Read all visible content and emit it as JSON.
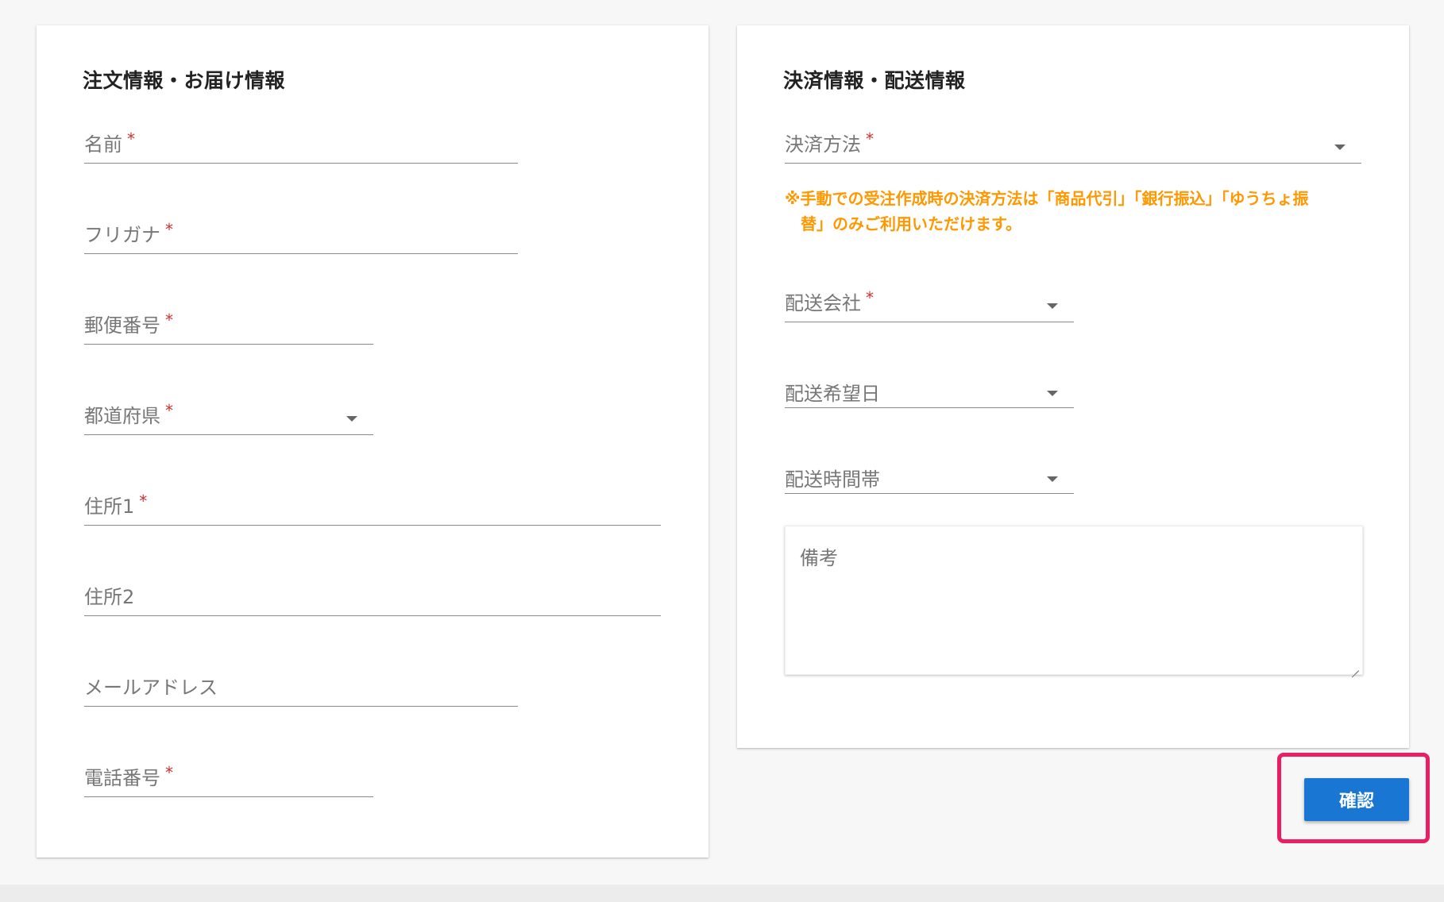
{
  "order_card": {
    "title": "注文情報・お届け情報",
    "fields": [
      {
        "label": "名前",
        "required": true
      },
      {
        "label": "フリガナ",
        "required": true
      },
      {
        "label": "郵便番号",
        "required": true
      },
      {
        "label": "都道府県",
        "required": true,
        "type": "select"
      },
      {
        "label": "住所1",
        "required": true
      },
      {
        "label": "住所2",
        "required": false
      },
      {
        "label": "メールアドレス",
        "required": false
      },
      {
        "label": "電話番号",
        "required": true
      }
    ]
  },
  "payment_card": {
    "title": "決済情報・配送情報",
    "payment_method": {
      "label": "決済方法",
      "required": true,
      "type": "select"
    },
    "note": "※手動での受注作成時の決済方法は「商品代引」「銀行振込」「ゆうちょ振替」のみご利用いただけます。",
    "delivery_company": {
      "label": "配送会社",
      "required": true,
      "type": "select"
    },
    "delivery_date": {
      "label": "配送希望日",
      "required": false,
      "type": "select"
    },
    "delivery_time": {
      "label": "配送時間帯",
      "required": false,
      "type": "select"
    },
    "remarks_placeholder": "備考"
  },
  "actions": {
    "confirm_label": "確認"
  },
  "required_mark": "*",
  "colors": {
    "primary": "#1976d2",
    "required": "#d32f2f",
    "note": "#ff9800",
    "highlight": "#e91e63"
  },
  "icons": {
    "select_caret": "caret-down-icon",
    "resize_handle": "resize-handle-icon"
  }
}
